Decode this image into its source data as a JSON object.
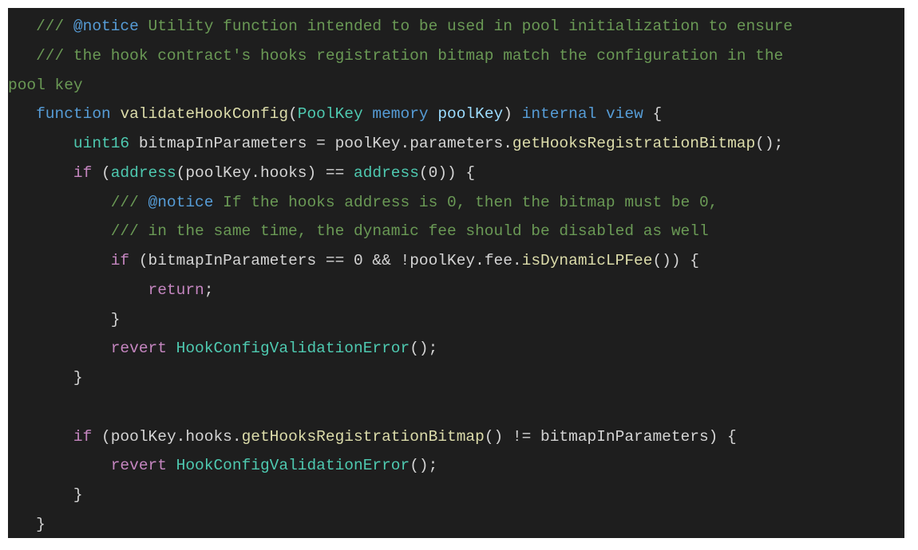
{
  "code": {
    "lines": [
      [
        {
          "t": "   /// ",
          "k": "comment"
        },
        {
          "t": "@notice",
          "k": "tag"
        },
        {
          "t": " Utility function intended to be used in pool initialization to ensure",
          "k": "comment"
        }
      ],
      [
        {
          "t": "   /// the hook contract's hooks registration bitmap match the configuration in the",
          "k": "comment"
        }
      ],
      [
        {
          "t": "pool key",
          "k": "comment"
        }
      ],
      [
        {
          "t": "   ",
          "k": "plain"
        },
        {
          "t": "function",
          "k": "keyword"
        },
        {
          "t": " ",
          "k": "plain"
        },
        {
          "t": "validateHookConfig",
          "k": "func"
        },
        {
          "t": "(",
          "k": "plain"
        },
        {
          "t": "PoolKey",
          "k": "type"
        },
        {
          "t": " ",
          "k": "plain"
        },
        {
          "t": "memory",
          "k": "keyword"
        },
        {
          "t": " ",
          "k": "plain"
        },
        {
          "t": "poolKey",
          "k": "param"
        },
        {
          "t": ") ",
          "k": "plain"
        },
        {
          "t": "internal",
          "k": "keyword"
        },
        {
          "t": " ",
          "k": "plain"
        },
        {
          "t": "view",
          "k": "keyword"
        },
        {
          "t": " {",
          "k": "plain"
        }
      ],
      [
        {
          "t": "       ",
          "k": "plain"
        },
        {
          "t": "uint16",
          "k": "type"
        },
        {
          "t": " bitmapInParameters = poolKey.parameters.",
          "k": "plain"
        },
        {
          "t": "getHooksRegistrationBitmap",
          "k": "func"
        },
        {
          "t": "();",
          "k": "plain"
        }
      ],
      [
        {
          "t": "       ",
          "k": "plain"
        },
        {
          "t": "if",
          "k": "control"
        },
        {
          "t": " (",
          "k": "plain"
        },
        {
          "t": "address",
          "k": "type"
        },
        {
          "t": "(poolKey.hooks) == ",
          "k": "plain"
        },
        {
          "t": "address",
          "k": "type"
        },
        {
          "t": "(0)) {",
          "k": "plain"
        }
      ],
      [
        {
          "t": "           /// ",
          "k": "comment"
        },
        {
          "t": "@notice",
          "k": "tag"
        },
        {
          "t": " If the hooks address is 0, then the bitmap must be 0,",
          "k": "comment"
        }
      ],
      [
        {
          "t": "           /// in the same time, the dynamic fee should be disabled as well",
          "k": "comment"
        }
      ],
      [
        {
          "t": "           ",
          "k": "plain"
        },
        {
          "t": "if",
          "k": "control"
        },
        {
          "t": " (bitmapInParameters == 0 && !poolKey.fee.",
          "k": "plain"
        },
        {
          "t": "isDynamicLPFee",
          "k": "func"
        },
        {
          "t": "()) {",
          "k": "plain"
        }
      ],
      [
        {
          "t": "               ",
          "k": "plain"
        },
        {
          "t": "return",
          "k": "control"
        },
        {
          "t": ";",
          "k": "plain"
        }
      ],
      [
        {
          "t": "           }",
          "k": "plain"
        }
      ],
      [
        {
          "t": "           ",
          "k": "plain"
        },
        {
          "t": "revert",
          "k": "control"
        },
        {
          "t": " ",
          "k": "plain"
        },
        {
          "t": "HookConfigValidationError",
          "k": "type"
        },
        {
          "t": "();",
          "k": "plain"
        }
      ],
      [
        {
          "t": "       }",
          "k": "plain"
        }
      ],
      [
        {
          "t": "",
          "k": "plain"
        }
      ],
      [
        {
          "t": "       ",
          "k": "plain"
        },
        {
          "t": "if",
          "k": "control"
        },
        {
          "t": " (poolKey.hooks.",
          "k": "plain"
        },
        {
          "t": "getHooksRegistrationBitmap",
          "k": "func"
        },
        {
          "t": "() != bitmapInParameters) {",
          "k": "plain"
        }
      ],
      [
        {
          "t": "           ",
          "k": "plain"
        },
        {
          "t": "revert",
          "k": "control"
        },
        {
          "t": " ",
          "k": "plain"
        },
        {
          "t": "HookConfigValidationError",
          "k": "type"
        },
        {
          "t": "();",
          "k": "plain"
        }
      ],
      [
        {
          "t": "       }",
          "k": "plain"
        }
      ],
      [
        {
          "t": "   }",
          "k": "plain"
        }
      ]
    ]
  }
}
